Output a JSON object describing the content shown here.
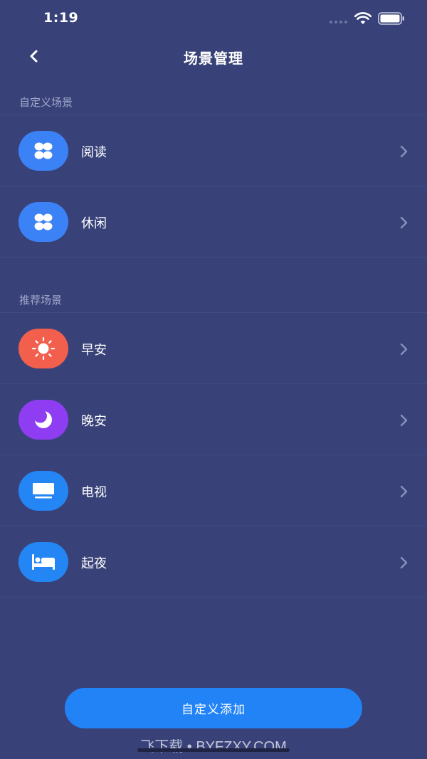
{
  "status_bar": {
    "time": "1:19"
  },
  "nav": {
    "title": "场景管理"
  },
  "custom_section": {
    "label": "自定义场景",
    "items": [
      {
        "label": "阅读",
        "icon": "clover-icon",
        "color": "#3b82f6"
      },
      {
        "label": "休闲",
        "icon": "clover-icon",
        "color": "#3b82f6"
      }
    ]
  },
  "recommended_section": {
    "label": "推荐场景",
    "items": [
      {
        "label": "早安",
        "icon": "sun-icon",
        "color": "#f25f4c"
      },
      {
        "label": "晚安",
        "icon": "moon-icon",
        "color": "#8f3df2"
      },
      {
        "label": "电视",
        "icon": "tv-icon",
        "color": "#2485f5"
      },
      {
        "label": "起夜",
        "icon": "bed-icon",
        "color": "#2485f5"
      }
    ]
  },
  "add_button": {
    "label": "自定义添加"
  },
  "watermark": "飞下载 • BYFZXY.COM",
  "colors": {
    "background": "#384279",
    "accent": "#2283f7"
  }
}
